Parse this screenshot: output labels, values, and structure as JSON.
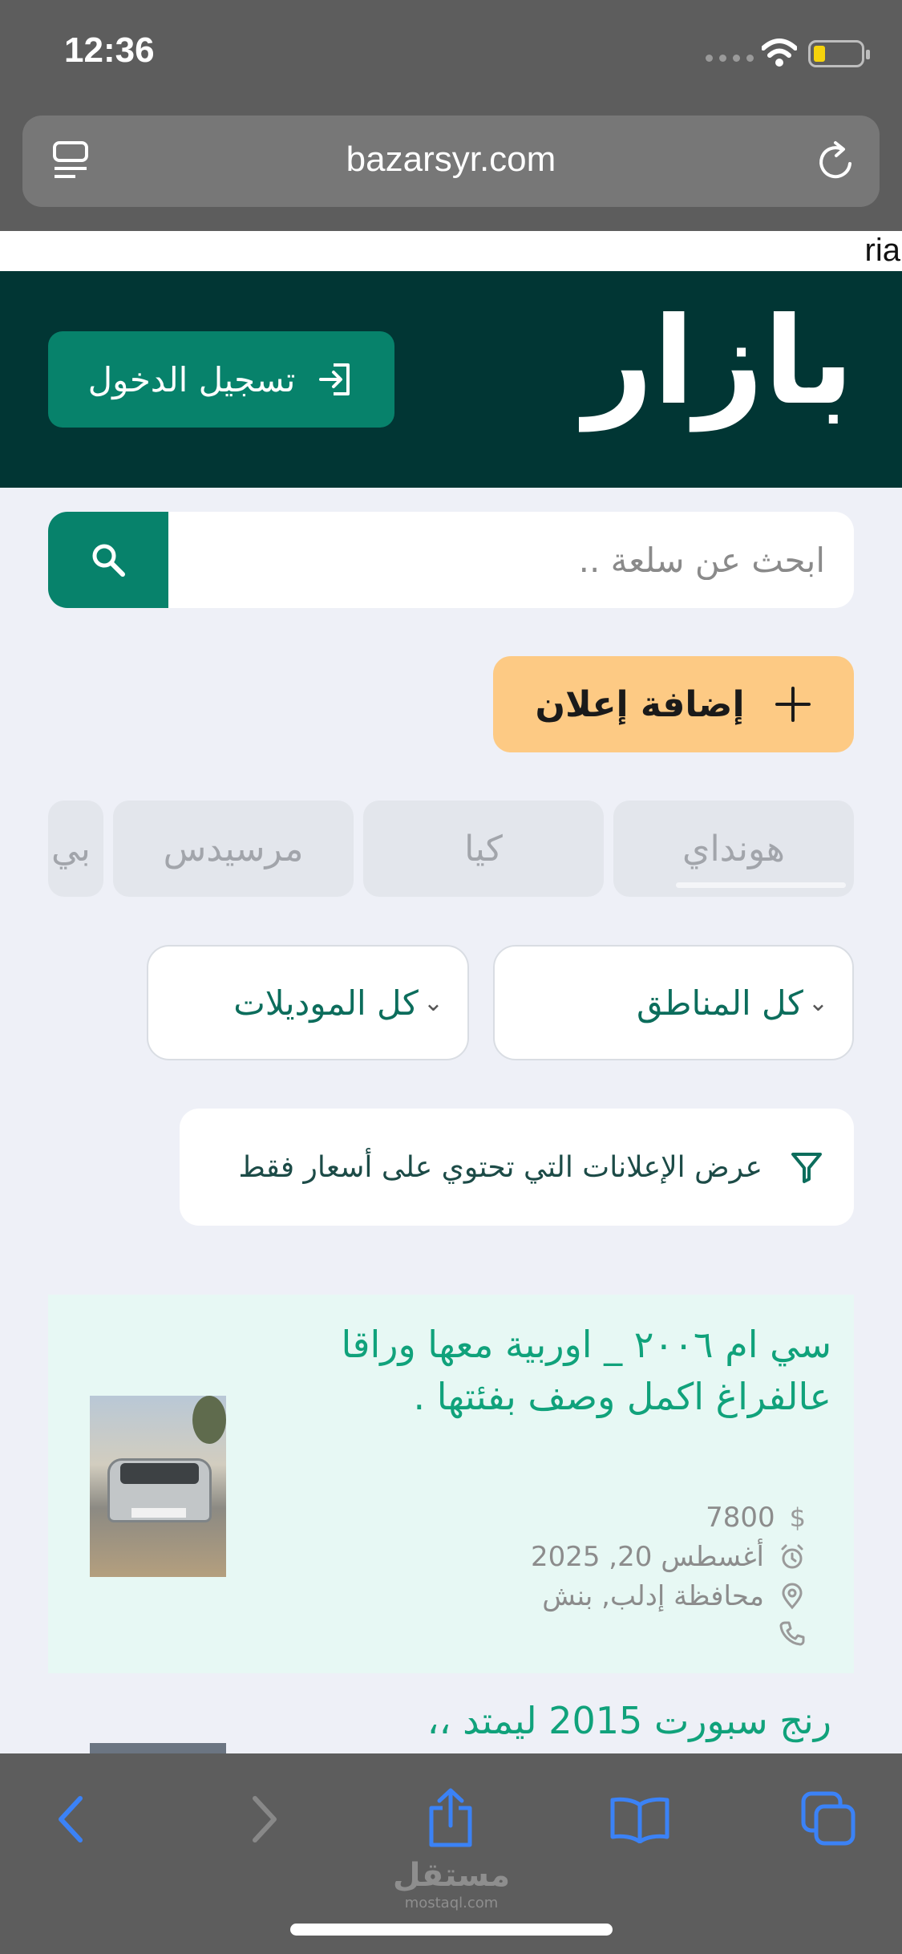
{
  "status_bar": {
    "time": "12:36"
  },
  "browser": {
    "url": "bazarsyr.com"
  },
  "stray_text": "ria",
  "header": {
    "logo": "بازار",
    "login_label": "تسجيل الدخول"
  },
  "search": {
    "placeholder": "ابحث عن سلعة .."
  },
  "add_ad": {
    "label": "إضافة إعلان"
  },
  "brand_chips": [
    "هونداي",
    "كيا",
    "مرسيدس",
    "بي"
  ],
  "filters": {
    "region": "كل المناطق",
    "model": "كل الموديلات",
    "price_only": "عرض الإعلانات التي تحتوي على أسعار فقط"
  },
  "listings": [
    {
      "title": "سي ام ٢٠٠٦ _ اوربية معها وراقا عالفراغ اكمل وصف بفئتها .",
      "price": "7800",
      "date": "أغسطس 20, 2025",
      "location": "محافظة إدلب, بنش"
    },
    {
      "title": "رنج سبورت 2015 ليمتد ،،"
    }
  ],
  "watermark": {
    "brand": "مستقل",
    "domain": "mostaql.com"
  },
  "colors": {
    "header_bg": "#013634",
    "accent": "#07826b",
    "add_button": "#fdca84",
    "listing_title": "#10a27b",
    "page_bg": "#eef0f7"
  }
}
